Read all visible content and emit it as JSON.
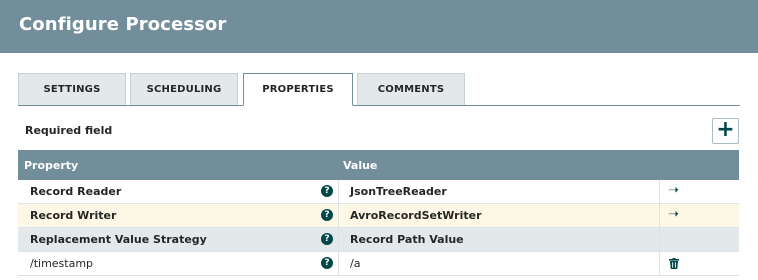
{
  "dialog": {
    "title": "Configure Processor"
  },
  "tabs": [
    {
      "label": "SETTINGS",
      "active": false
    },
    {
      "label": "SCHEDULING",
      "active": false
    },
    {
      "label": "PROPERTIES",
      "active": true
    },
    {
      "label": "COMMENTS",
      "active": false
    }
  ],
  "properties": {
    "required_label": "Required field",
    "add_icon": "plus-icon",
    "columns": {
      "property": "Property",
      "value": "Value"
    },
    "rows": [
      {
        "property": "Record Reader",
        "value": "JsonTreeReader",
        "required": true,
        "action": "go-to-arrow-icon"
      },
      {
        "property": "Record Writer",
        "value": "AvroRecordSetWriter",
        "required": true,
        "action": "go-to-arrow-icon"
      },
      {
        "property": "Replacement Value Strategy",
        "value": "Record Path Value",
        "required": true,
        "action": ""
      },
      {
        "property": "/timestamp",
        "value": "/a",
        "required": false,
        "action": "trash-icon"
      }
    ],
    "help_icon": "question-circle-icon"
  },
  "colors": {
    "header_bg": "#728e9b",
    "accent": "#004849",
    "row_alt": "#fdf8e5",
    "row_highlight": "#e3e8eb"
  }
}
